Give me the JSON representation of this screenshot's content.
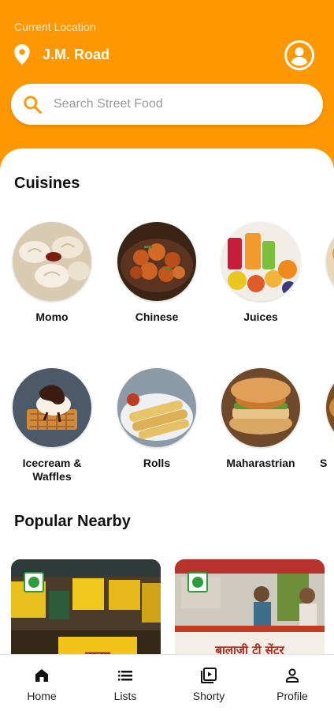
{
  "header": {
    "location_caption": "Current Location",
    "location_name": "J.M. Road"
  },
  "search": {
    "placeholder": "Search Street Food"
  },
  "sections": {
    "cuisines_title": "Cuisines",
    "popular_title": "Popular Nearby"
  },
  "cuisines_row1": [
    {
      "label": "Momo"
    },
    {
      "label": "Chinese"
    },
    {
      "label": "Juices"
    }
  ],
  "cuisines_row2": [
    {
      "label": "Icecream & Waffles"
    },
    {
      "label": "Rolls"
    },
    {
      "label": "Maharastrian"
    },
    {
      "label": "S"
    }
  ],
  "popular": [
    {
      "sign_text": "तात्या",
      "badge": "veg"
    },
    {
      "sign_text": "बालाजी टी सेंटर",
      "badge": "veg"
    }
  ],
  "nav": [
    {
      "label": "Home",
      "icon": "home-icon"
    },
    {
      "label": "Lists",
      "icon": "list-icon"
    },
    {
      "label": "Shorty",
      "icon": "video-library-icon"
    },
    {
      "label": "Profile",
      "icon": "person-icon"
    }
  ],
  "colors": {
    "accent": "#FF9800",
    "veg_green": "#2E9E3C"
  }
}
